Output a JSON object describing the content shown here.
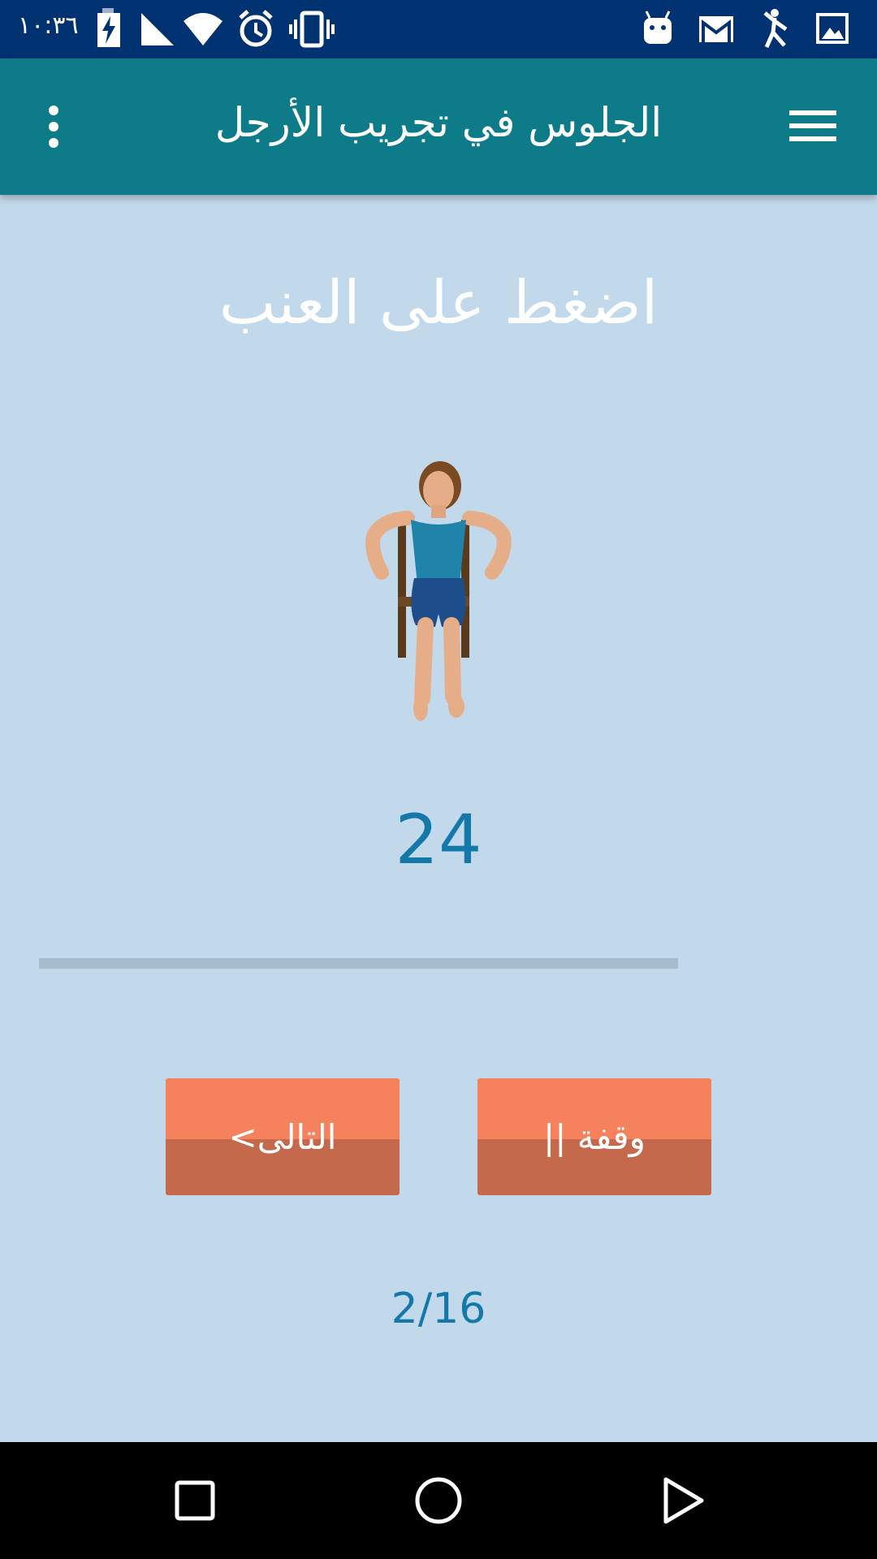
{
  "status_bar": {
    "time": "١٠:٣٦",
    "icons": [
      "battery-charging-icon",
      "signal-icon",
      "wifi-icon",
      "alarm-icon",
      "vibrate-icon",
      "android-icon",
      "gmail-icon",
      "dancer-icon",
      "image-icon"
    ]
  },
  "app_bar": {
    "title": "الجلوس في تجريب الأرجل",
    "menu_icon": "hamburger-menu-icon",
    "more_icon": "more-vert-icon"
  },
  "exercise": {
    "name": "اضغط على العنب",
    "image": "seated-woman-exercise-figure",
    "count": "24"
  },
  "progress": {
    "fraction": 1.0
  },
  "buttons": {
    "next_label": "التالى>",
    "pause_label": "وقفة ||"
  },
  "page_counter": "2/16",
  "nav_bar": {
    "icons": [
      "recents-icon",
      "home-icon",
      "back-icon"
    ]
  },
  "colors": {
    "status_bar": "#003170",
    "app_bar": "#0e7b88",
    "background": "#c2d8eb",
    "accent_text": "#1479a9",
    "button_top": "#f5825c",
    "button_bottom": "#c4694c"
  }
}
